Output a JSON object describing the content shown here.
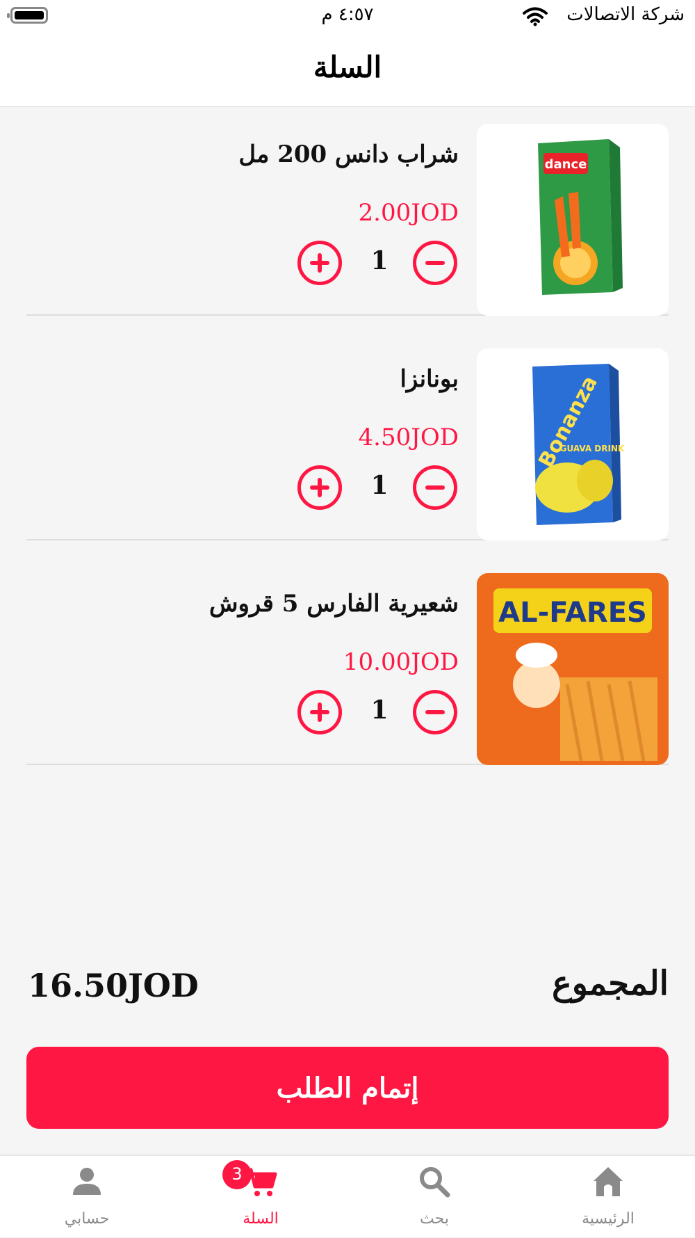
{
  "status_bar": {
    "carrier": "شركة الاتصالات",
    "time": "٤:٥٧ م",
    "icons": [
      "wifi-icon",
      "battery-icon"
    ]
  },
  "header": {
    "title": "السلة"
  },
  "cart": {
    "items": [
      {
        "name": "شراب دانس 200 مل",
        "price": "2.00JOD",
        "quantity": "1",
        "image": "dance-juice-box"
      },
      {
        "name": "بونانزا",
        "price": "4.50JOD",
        "quantity": "1",
        "image": "bonanza-guava-drink"
      },
      {
        "name": "شعيرية الفارس 5 قروش",
        "price": "10.00JOD",
        "quantity": "1",
        "image": "al-fares-snack-bag"
      }
    ],
    "total_label": "المجموع",
    "total_value": "16.50JOD",
    "checkout_label": "إتمام الطلب"
  },
  "tab_bar": {
    "tabs": [
      {
        "label": "حسابي",
        "icon": "person-icon"
      },
      {
        "label": "السلة",
        "icon": "cart-icon",
        "badge": "3",
        "active": true
      },
      {
        "label": "بحث",
        "icon": "search-icon"
      },
      {
        "label": "الرئيسية",
        "icon": "home-icon"
      }
    ]
  },
  "colors": {
    "accent": "#ff1744",
    "background": "#f5f5f5",
    "inactive": "#8a8a8a"
  },
  "product_image_text": {
    "dance": "dance",
    "bonanza": "Bonanza",
    "bonanza_sub": "GUAVA DRINK",
    "al_fares": "AL-FARES"
  }
}
